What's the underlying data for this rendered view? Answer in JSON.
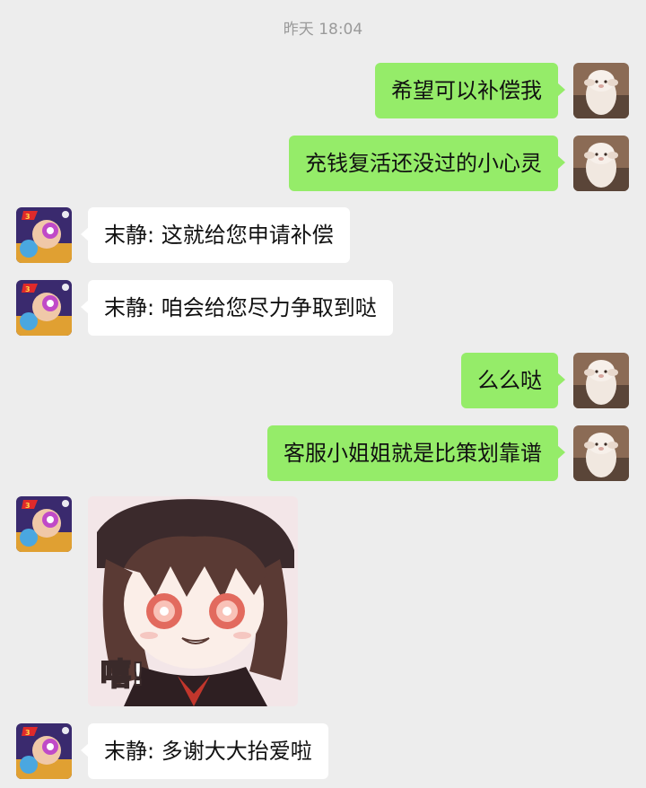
{
  "timestamp": "昨天 18:04",
  "colors": {
    "background": "#ededed",
    "bubble_sent": "#95ec69",
    "bubble_received": "#ffffff"
  },
  "messages": [
    {
      "side": "right",
      "text": "希望可以补偿我"
    },
    {
      "side": "right",
      "text": "充钱复活还没过的小心灵"
    },
    {
      "side": "left",
      "text": "末静: 这就给您申请补偿"
    },
    {
      "side": "left",
      "text": "末静: 咱会给您尽力争取到哒"
    },
    {
      "side": "right",
      "text": "么么哒"
    },
    {
      "side": "right",
      "text": "客服小姐姐就是比策划靠谱"
    },
    {
      "side": "left",
      "type": "sticker",
      "caption": "嘻!"
    },
    {
      "side": "left",
      "text": "末静: 多谢大大抬爱啦"
    }
  ],
  "icons": {
    "sender_avatar": "sheep-avatar-icon",
    "agent_avatar": "game-anniversary-avatar-icon"
  }
}
